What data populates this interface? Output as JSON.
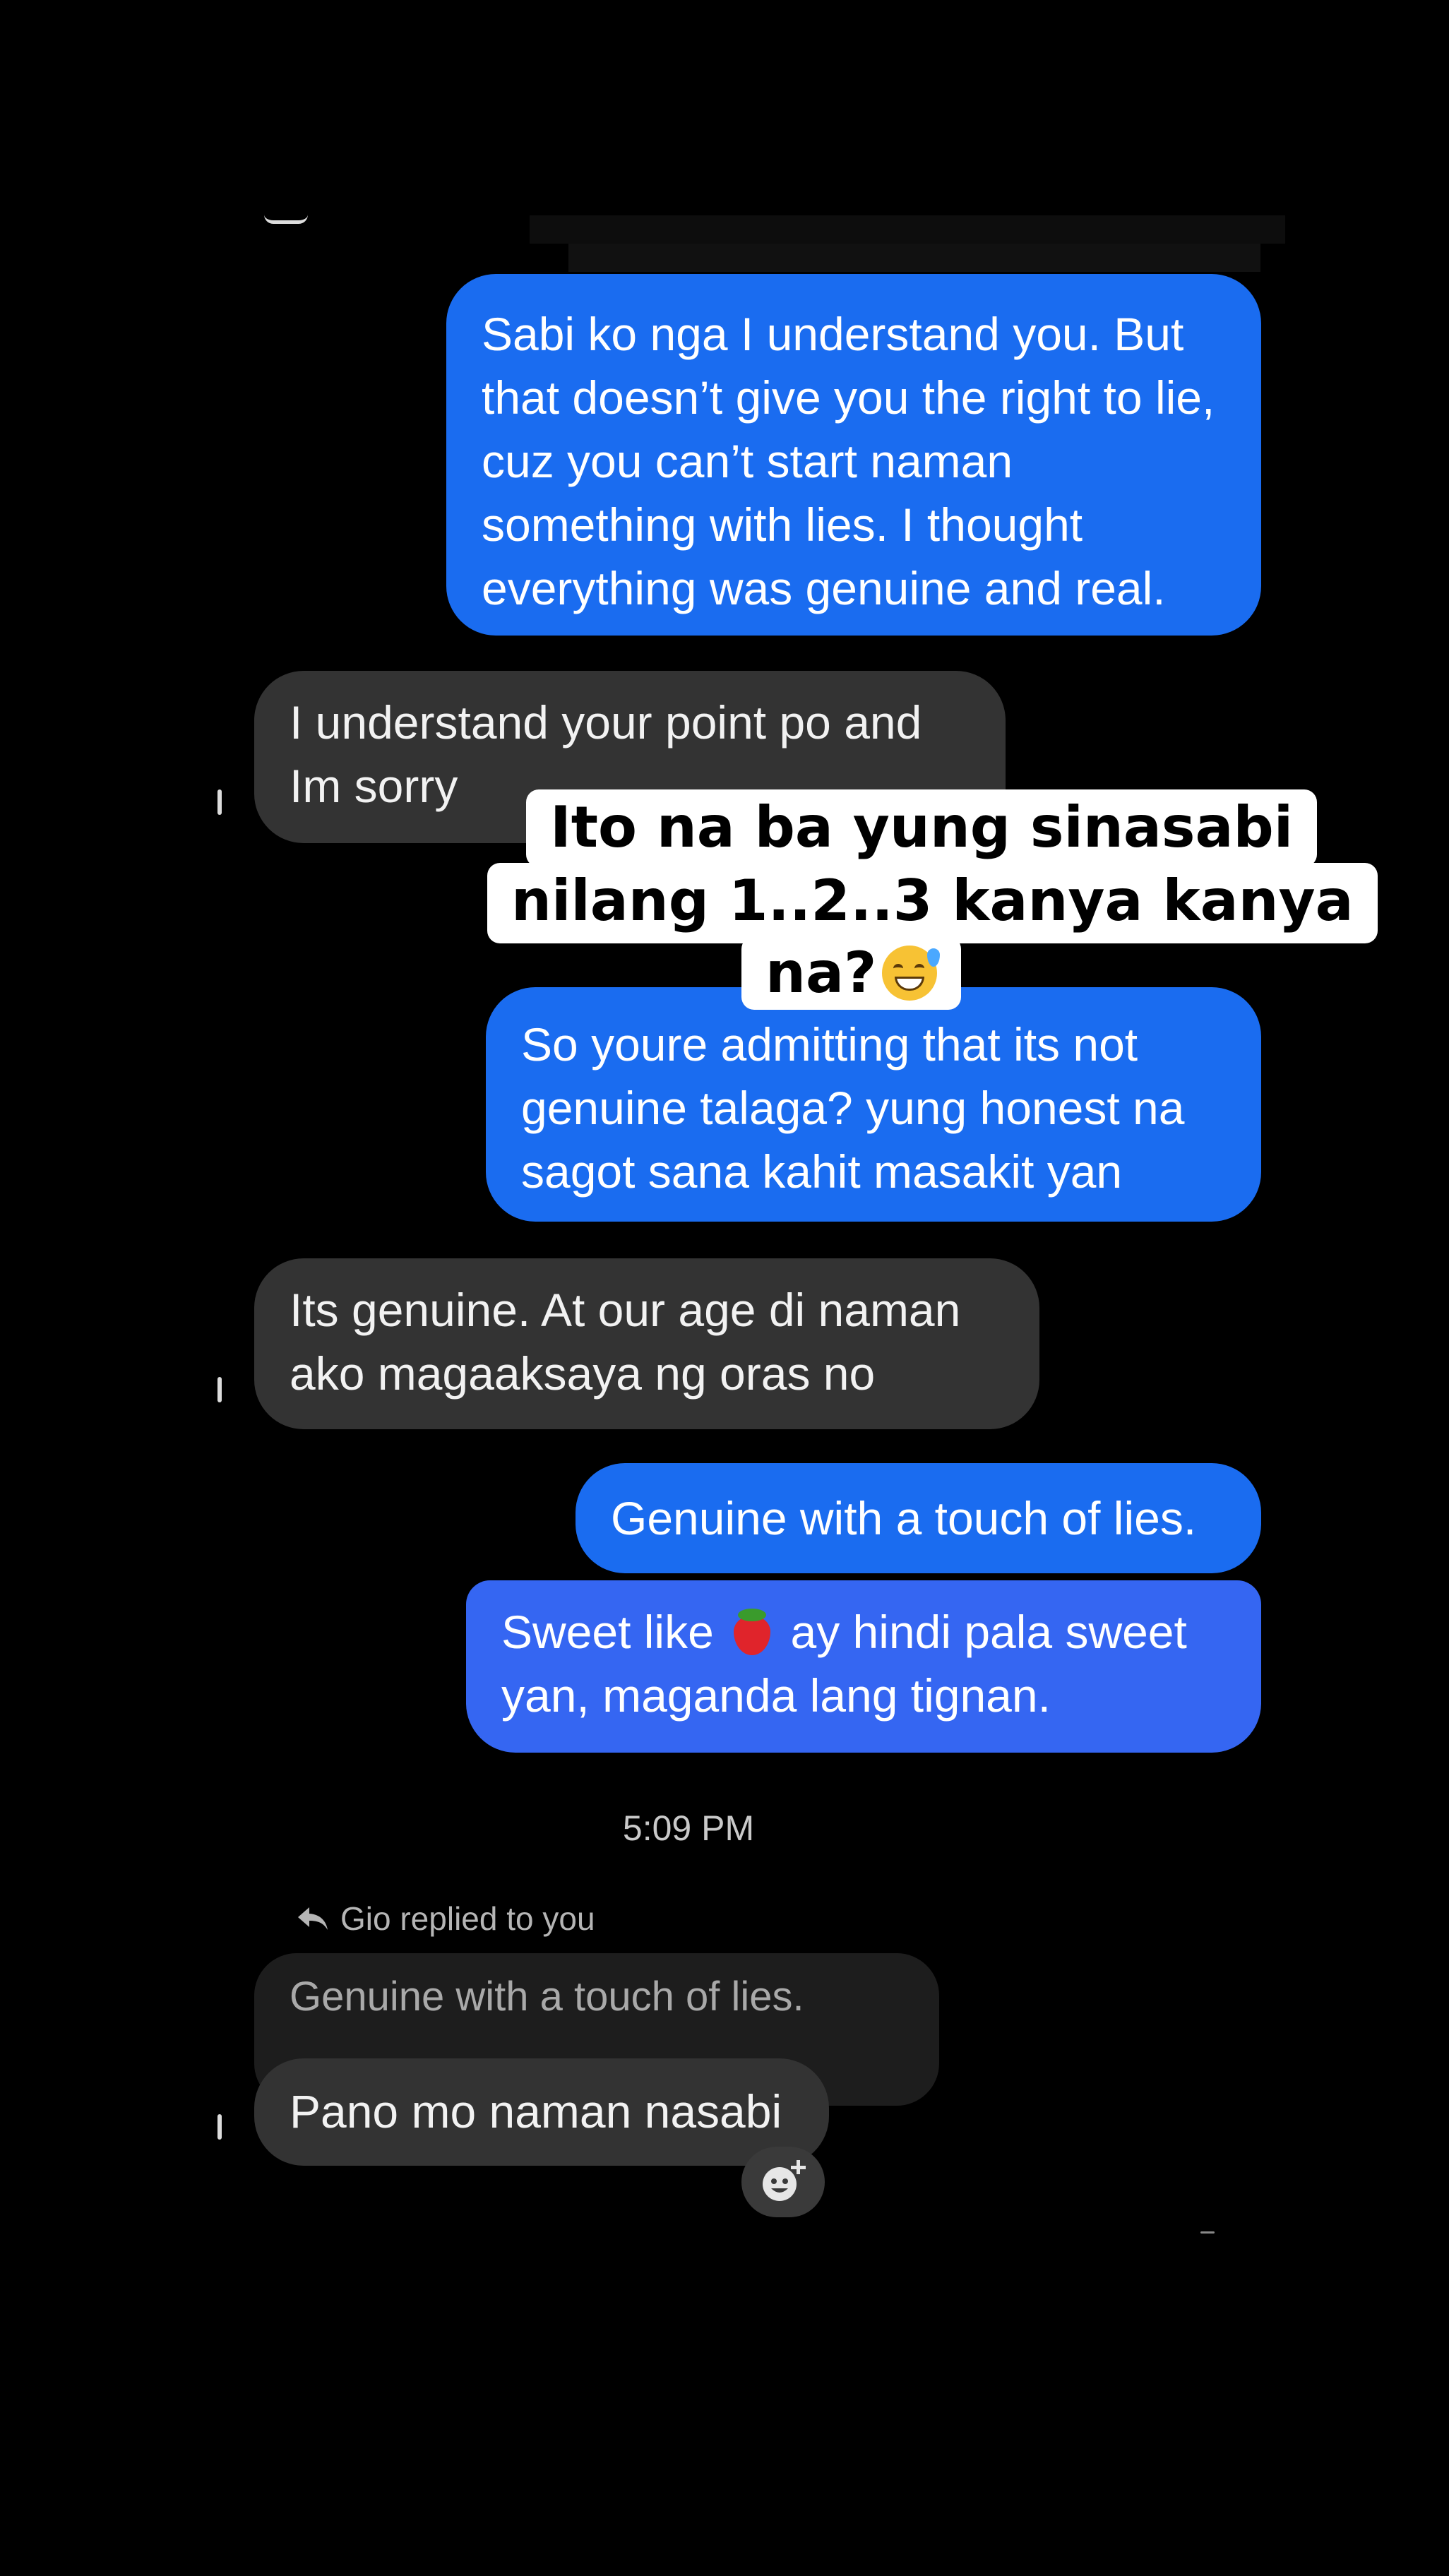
{
  "thread": {
    "messages": [
      {
        "direction": "out",
        "text": "Sabi ko nga I understand you. But that doesn’t give you the right to lie, cuz you can’t start naman something with lies. I thought everything was genuine and real."
      },
      {
        "direction": "in",
        "text": "I understand your point po and Im sorry"
      },
      {
        "direction": "out",
        "text": "So youre admitting that its not genuine talaga? yung honest na sagot sana kahit masakit yan"
      },
      {
        "direction": "in",
        "text": "Its genuine. At our age di naman ako magaaksaya ng oras no"
      },
      {
        "direction": "out",
        "text": "Genuine with a touch of lies."
      },
      {
        "direction": "out",
        "text_before": "Sweet like",
        "emoji": "strawberry",
        "text_after": "ay hindi pala sweet yan, maganda lang tignan."
      }
    ],
    "timestamp": "5:09 PM",
    "reply_note": "Gio replied to you",
    "quoted_text": "Genuine with a touch of lies.",
    "reply_message": "Pano mo naman nasabi"
  },
  "caption": {
    "line1": "Ito na ba yung sinasabi",
    "line2": "nilang 1..2..3 kanya kanya",
    "line3": "na?",
    "emoji": "grinning-face-with-sweat"
  },
  "colors": {
    "outgoing": "#1a6cf0",
    "incoming": "#333333",
    "background": "#000000"
  },
  "icons": [
    "reply-arrow-icon",
    "add-reaction-icon",
    "strawberry-emoji",
    "sweat-smile-emoji"
  ]
}
